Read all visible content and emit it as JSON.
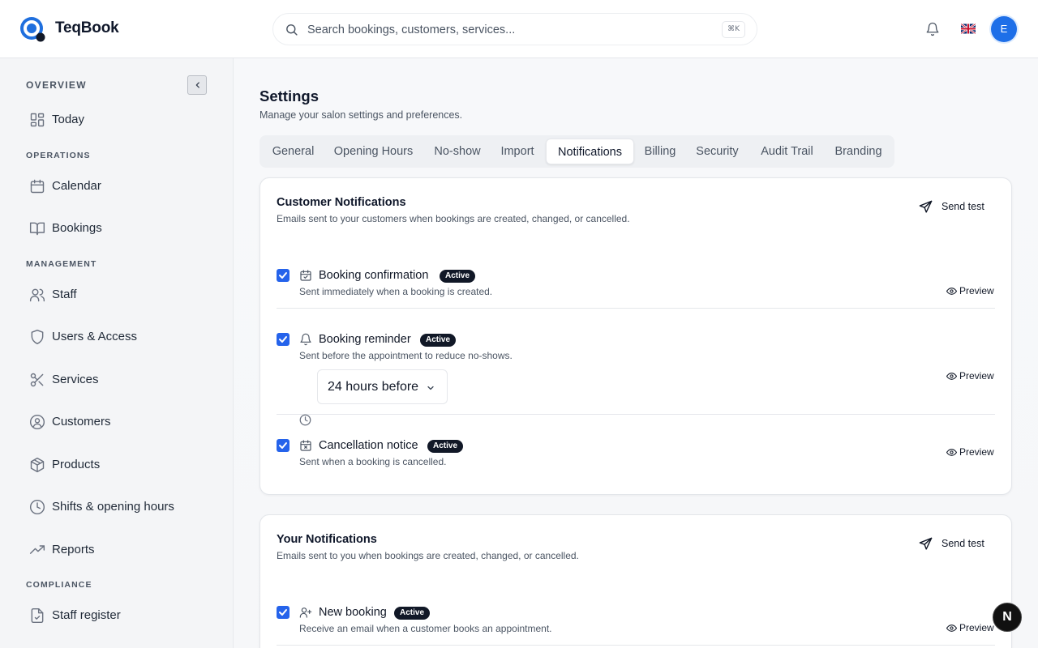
{
  "app": {
    "name": "TeqBook"
  },
  "header": {
    "search_placeholder": "Search bookings, customers, services...",
    "search_shortcut": "⌘K",
    "avatar_initial": "E",
    "language": "English (UK)"
  },
  "sidebar": {
    "sections": {
      "overview": "OVERVIEW",
      "operations": "OPERATIONS",
      "management": "MANAGEMENT",
      "compliance": "COMPLIANCE"
    },
    "items": {
      "today": "Today",
      "calendar": "Calendar",
      "bookings": "Bookings",
      "staff": "Staff",
      "users": "Users & Access",
      "services": "Services",
      "customers": "Customers",
      "products": "Products",
      "shifts": "Shifts & opening hours",
      "reports": "Reports",
      "register": "Staff register"
    }
  },
  "page": {
    "title": "Settings",
    "subtitle": "Manage your salon settings and preferences."
  },
  "tabs": [
    "General",
    "Opening Hours",
    "No-show",
    "Import",
    "Notifications",
    "Billing",
    "Security",
    "Audit Trail",
    "Branding"
  ],
  "active_tab": "Notifications",
  "customer_card": {
    "title": "Customer Notifications",
    "description": "Emails sent to your customers when bookings are created, changed, or cancelled.",
    "send_test": "Send test",
    "items": [
      {
        "name": "Booking confirmation",
        "badge": "Active",
        "description": "Sent immediately when a booking is created.",
        "preview": "Preview",
        "enabled": true
      },
      {
        "name": "Booking reminder",
        "badge": "Active",
        "description": "Sent before the appointment to reduce no-shows.",
        "preview": "Preview",
        "enabled": true,
        "timing": "24 hours before"
      },
      {
        "name": "Cancellation notice",
        "badge": "Active",
        "description": "Sent when a booking is cancelled.",
        "preview": "Preview",
        "enabled": true
      }
    ]
  },
  "your_card": {
    "title": "Your Notifications",
    "description": "Emails sent to you when bookings are created, changed, or cancelled.",
    "send_test": "Send test",
    "items": [
      {
        "name": "New booking",
        "badge": "Active",
        "description": "Receive an email when a customer books an appointment.",
        "preview": "Preview",
        "enabled": true
      }
    ]
  },
  "fab": {
    "label": "N"
  },
  "colors": {
    "accent": "#2563eb",
    "badge_bg": "#111827",
    "avatar_bg": "#1e6fe8"
  }
}
